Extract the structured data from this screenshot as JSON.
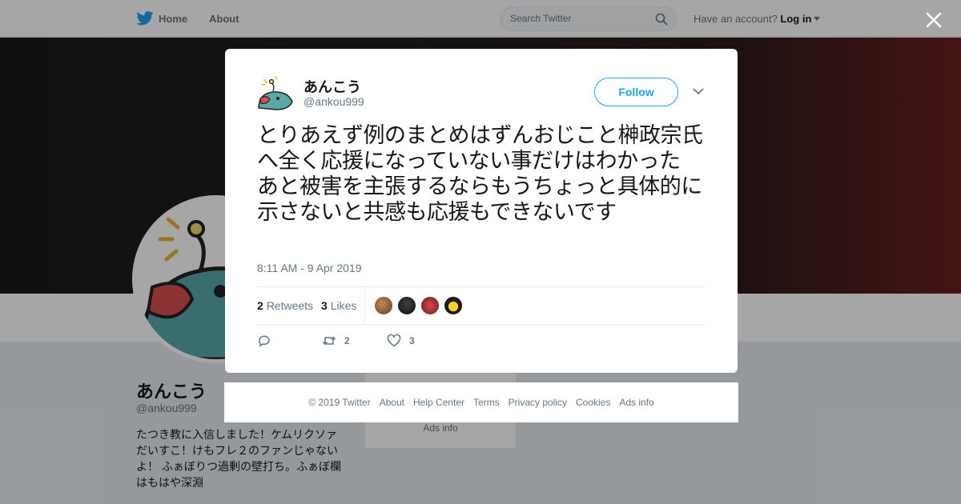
{
  "nav": {
    "home": "Home",
    "about": "About",
    "search_placeholder": "Search Twitter",
    "account_prompt": "Have an account?",
    "login": "Log in"
  },
  "profile": {
    "name": "あんこう",
    "handle": "@ankou999",
    "bio": "たつき教に入信しました！ケムリクソァだいすこ！けもフレ２のファンじゃないよ！ ふぁぼりつ過剰の壁打ち。ふぁぼ欄はもはや深淵",
    "sidebox_ads": "Ads info"
  },
  "tweet": {
    "name": "あんこう",
    "handle": "@ankou999",
    "follow_label": "Follow",
    "text": "とりあえず例のまとめはずんおじこと榊政宗氏へ全く応援になっていない事だけはわかった\nあと被害を主張するならもうちょっと具体的に示さないと共感も応援もできないです",
    "timestamp": "8:11 AM - 9 Apr 2019",
    "retweets_count": "2",
    "retweets_label": "Retweets",
    "likes_count": "3",
    "likes_label": "Likes",
    "actions": {
      "retweet_count": "2",
      "like_count": "3"
    }
  },
  "footer": {
    "copyright": "© 2019 Twitter",
    "links": [
      "About",
      "Help Center",
      "Terms",
      "Privacy policy",
      "Cookies",
      "Ads info"
    ]
  },
  "colors": {
    "brand": "#1da1f2",
    "overlay": "rgba(0,0,0,0.35)",
    "text_secondary": "#657786"
  },
  "icons": [
    "twitter-bird-icon",
    "search-icon",
    "close-icon",
    "chevron-down-icon",
    "reply-icon",
    "retweet-icon",
    "heart-icon"
  ]
}
